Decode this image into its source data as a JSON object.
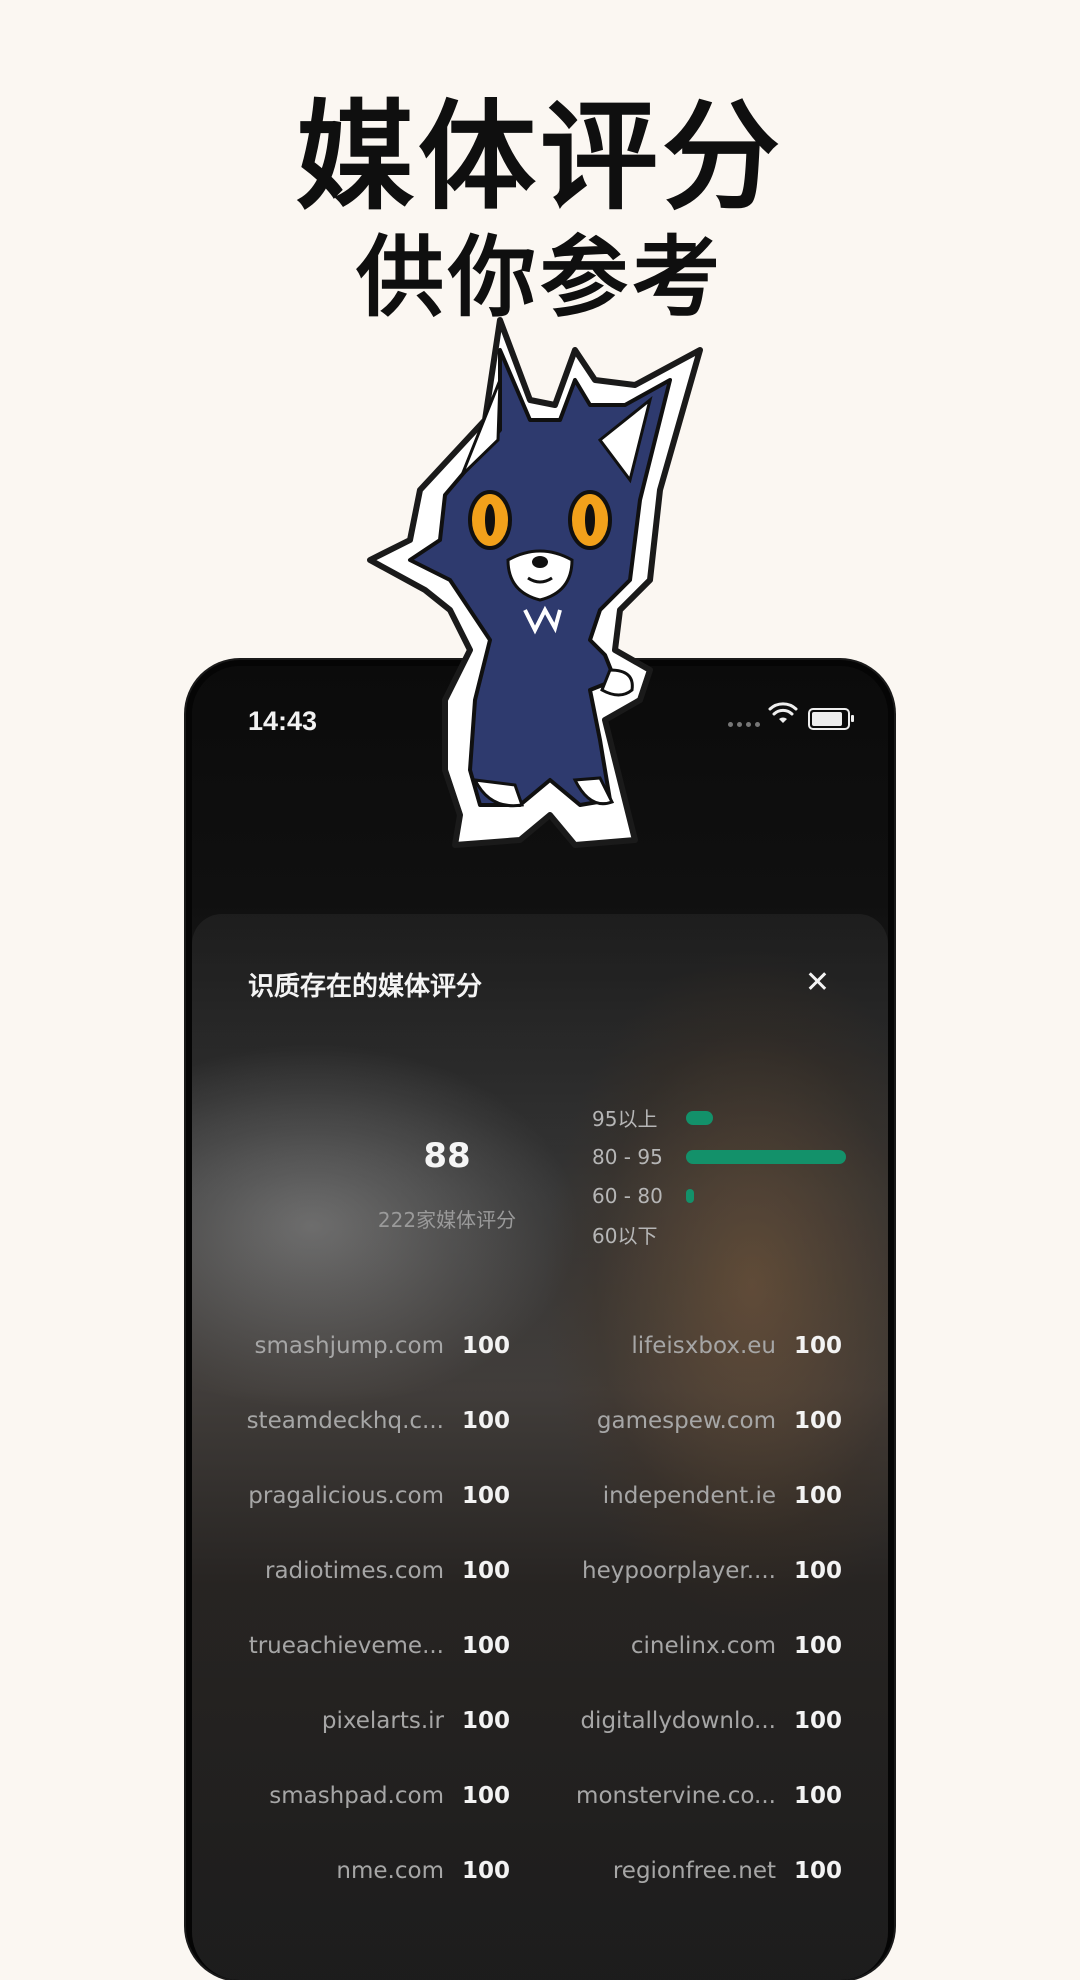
{
  "promo": {
    "title": "媒体评分",
    "subtitle": "供你参考"
  },
  "status_bar": {
    "time": "14:43"
  },
  "sheet": {
    "title": "识质存在的媒体评分",
    "close_glyph": "✕",
    "score": "88",
    "score_caption": "222家媒体评分",
    "distribution": [
      {
        "label": "95以上",
        "fraction": 0.17
      },
      {
        "label": "80 - 95",
        "fraction": 1.0
      },
      {
        "label": "60 - 80",
        "fraction": 0.05
      },
      {
        "label": "60以下",
        "fraction": 0.0
      }
    ],
    "reviews": [
      {
        "left_site": "smashjump.com",
        "left_score": "100",
        "right_site": "lifeisxbox.eu",
        "right_score": "100"
      },
      {
        "left_site": "steamdeckhq.c...",
        "left_score": "100",
        "right_site": "gamespew.com",
        "right_score": "100"
      },
      {
        "left_site": "pragalicious.com",
        "left_score": "100",
        "right_site": "independent.ie",
        "right_score": "100"
      },
      {
        "left_site": "radiotimes.com",
        "left_score": "100",
        "right_site": "heypoorplayer....",
        "right_score": "100"
      },
      {
        "left_site": "trueachieveme...",
        "left_score": "100",
        "right_site": "cinelinx.com",
        "right_score": "100"
      },
      {
        "left_site": "pixelarts.ir",
        "left_score": "100",
        "right_site": "digitallydownlo...",
        "right_score": "100"
      },
      {
        "left_site": "smashpad.com",
        "left_score": "100",
        "right_site": "monstervine.co...",
        "right_score": "100"
      },
      {
        "left_site": "nme.com",
        "left_score": "100",
        "right_site": "regionfree.net",
        "right_score": "100"
      }
    ]
  },
  "colors": {
    "bar_green": "#13916a",
    "page_bg": "#fbf7f2"
  },
  "icons": [
    "wifi-icon",
    "battery-icon",
    "signal-icon",
    "close-icon",
    "cat-mascot-icon"
  ]
}
